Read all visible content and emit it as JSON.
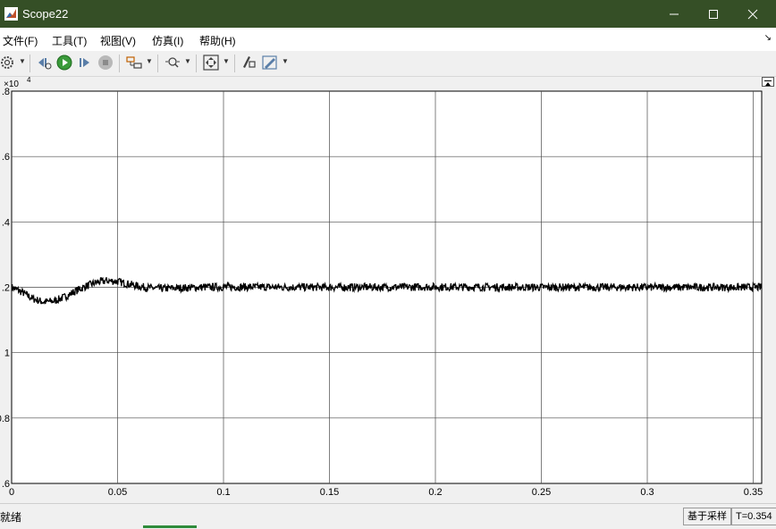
{
  "window": {
    "title": "Scope22",
    "icon": "matlab-icon",
    "controls": [
      "minimize-icon",
      "maximize-icon",
      "close-icon"
    ]
  },
  "menu": {
    "items": [
      "文件(F)",
      "工具(T)",
      "视图(V)",
      "仿真(I)",
      "帮助(H)"
    ],
    "dock_icon": "dock-arrow-icon"
  },
  "toolbar": {
    "icons": [
      "settings-icon",
      "step-back-icon",
      "run-icon",
      "step-forward-icon",
      "stop-icon",
      "signal-selector-icon",
      "zoom-icon",
      "autoscale-icon",
      "highlight-block-icon",
      "triggers-icon"
    ]
  },
  "chart_data": {
    "type": "line",
    "title": "",
    "xlabel": "",
    "ylabel": "",
    "exponent_label": "×10",
    "exponent_power": "4",
    "xlim": [
      0,
      0.354
    ],
    "ylim": [
      0.6,
      1.8
    ],
    "xticks": [
      0,
      0.05,
      0.1,
      0.15,
      0.2,
      0.25,
      0.3,
      0.35
    ],
    "xtick_labels": [
      "0",
      "0.05",
      "0.1",
      "0.15",
      "0.2",
      "0.25",
      "0.3",
      "0.35"
    ],
    "yticks": [
      0.6,
      0.8,
      1.0,
      1.2,
      1.4,
      1.6,
      1.8
    ],
    "ytick_labels": [
      ".6",
      "0.8",
      "1",
      ".2",
      ".4",
      ".6",
      ".8"
    ],
    "grid": true,
    "series": [
      {
        "color": "#000000",
        "noise_amplitude": 0.012,
        "x": [
          0,
          0.005,
          0.01,
          0.015,
          0.02,
          0.025,
          0.03,
          0.035,
          0.04,
          0.045,
          0.05,
          0.055,
          0.06,
          0.065,
          0.07,
          0.08,
          0.09,
          0.1,
          0.15,
          0.2,
          0.25,
          0.3,
          0.354
        ],
        "y": [
          1.2,
          1.185,
          1.165,
          1.155,
          1.158,
          1.17,
          1.188,
          1.203,
          1.215,
          1.22,
          1.218,
          1.21,
          1.203,
          1.198,
          1.196,
          1.198,
          1.2,
          1.201,
          1.2,
          1.201,
          1.2,
          1.2,
          1.2
        ]
      }
    ]
  },
  "status": {
    "text": "就绪",
    "mode": "基于采样",
    "time": "T=0.354"
  }
}
